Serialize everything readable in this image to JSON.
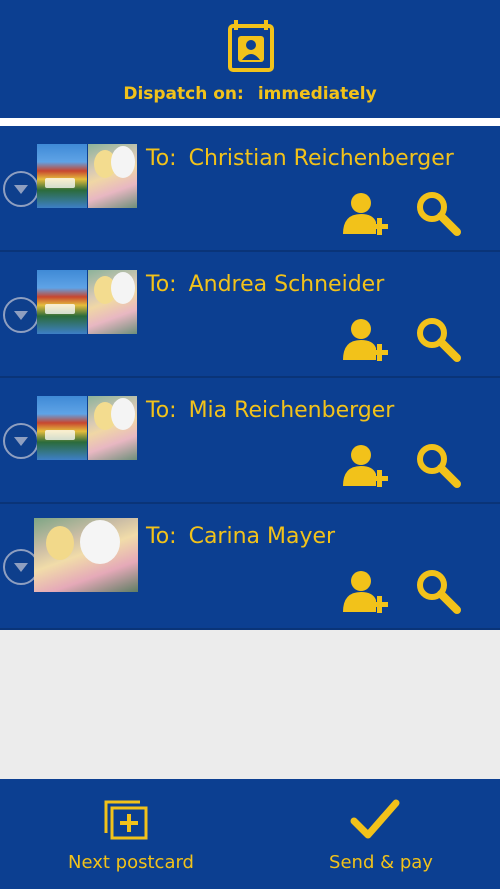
{
  "header": {
    "dispatch_label": "Dispatch on:",
    "dispatch_value": "immediately",
    "icon": "calendar-contact-icon"
  },
  "recipients": [
    {
      "prefix": "To:",
      "name": "Christian Reichenberger",
      "thumbnails": [
        "park-photo",
        "person-mascot-photo"
      ]
    },
    {
      "prefix": "To:",
      "name": "Andrea Schneider",
      "thumbnails": [
        "park-photo",
        "person-mascot-photo"
      ]
    },
    {
      "prefix": "To:",
      "name": "Mia Reichenberger",
      "thumbnails": [
        "park-photo",
        "person-mascot-photo"
      ]
    },
    {
      "prefix": "To:",
      "name": "Carina Mayer",
      "thumbnails": [
        "person-mascot-photo"
      ]
    }
  ],
  "row_icons": [
    "chevron-down-icon",
    "add-contact-icon",
    "search-icon"
  ],
  "footer": {
    "next_label": "Next postcard",
    "next_icon": "add-postcard-icon",
    "send_label": "Send & pay",
    "send_icon": "checkmark-icon"
  },
  "colors": {
    "primary": "#0c3f91",
    "accent": "#f2c21a",
    "background": "#ececec"
  }
}
